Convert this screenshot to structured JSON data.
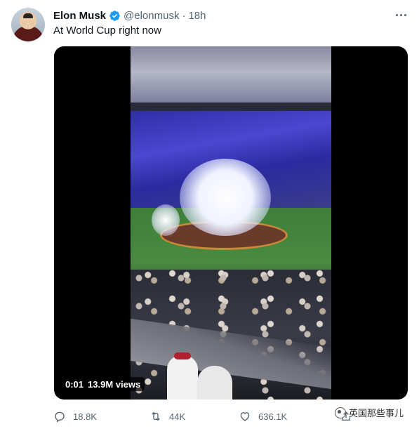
{
  "author": {
    "name": "Elon Musk",
    "handle": "@elonmusk",
    "separator": "·",
    "time": "18h",
    "verified": true
  },
  "tweet": {
    "text": "At World Cup right now"
  },
  "media": {
    "current_time": "0:01",
    "views": "13.9M views"
  },
  "actions": {
    "replies": "18.8K",
    "retweets": "44K",
    "likes": "636.1K"
  },
  "watermark": {
    "text": "英国那些事儿"
  },
  "icons": {
    "more": "more-horizontal-icon",
    "verified": "verified-badge-icon",
    "reply": "reply-icon",
    "retweet": "retweet-icon",
    "like": "heart-icon",
    "share": "share-icon"
  },
  "colors": {
    "secondary_text": "#536471",
    "verified_blue": "#1d9bf0"
  }
}
